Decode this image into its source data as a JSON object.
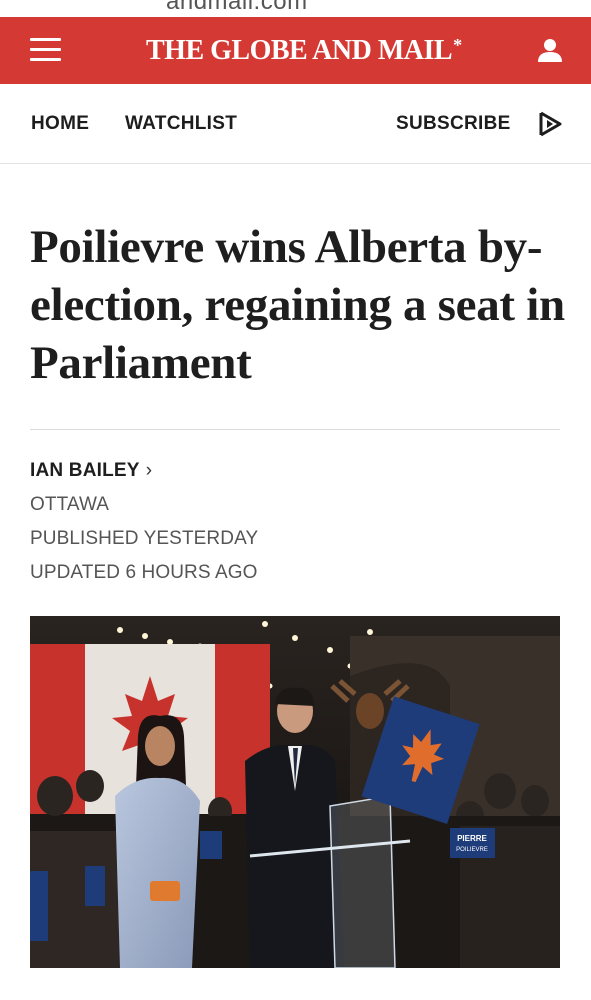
{
  "browser": {
    "url_fragment": "andmail.com"
  },
  "header": {
    "brand": "THE GLOBE AND MAIL",
    "brand_mark": "*",
    "menu_icon": "hamburger-menu-icon",
    "account_icon": "user-icon",
    "background_color": "#d43a33"
  },
  "nav": {
    "home": "HOME",
    "watchlist": "WATCHLIST",
    "subscribe": "SUBSCRIBE",
    "video_icon": "play-video-icon"
  },
  "article": {
    "headline": "Poilievre wins Alberta by-election, regaining a seat in Parliament",
    "author": "IAN BAILEY",
    "author_chevron": "›",
    "location": "OTTAWA",
    "published": "PUBLISHED YESTERDAY",
    "updated": "UPDATED 6 HOURS AGO"
  },
  "photo": {
    "sign_text_line1": "PIERRE",
    "sign_text_line2": "POILIEVRE"
  }
}
